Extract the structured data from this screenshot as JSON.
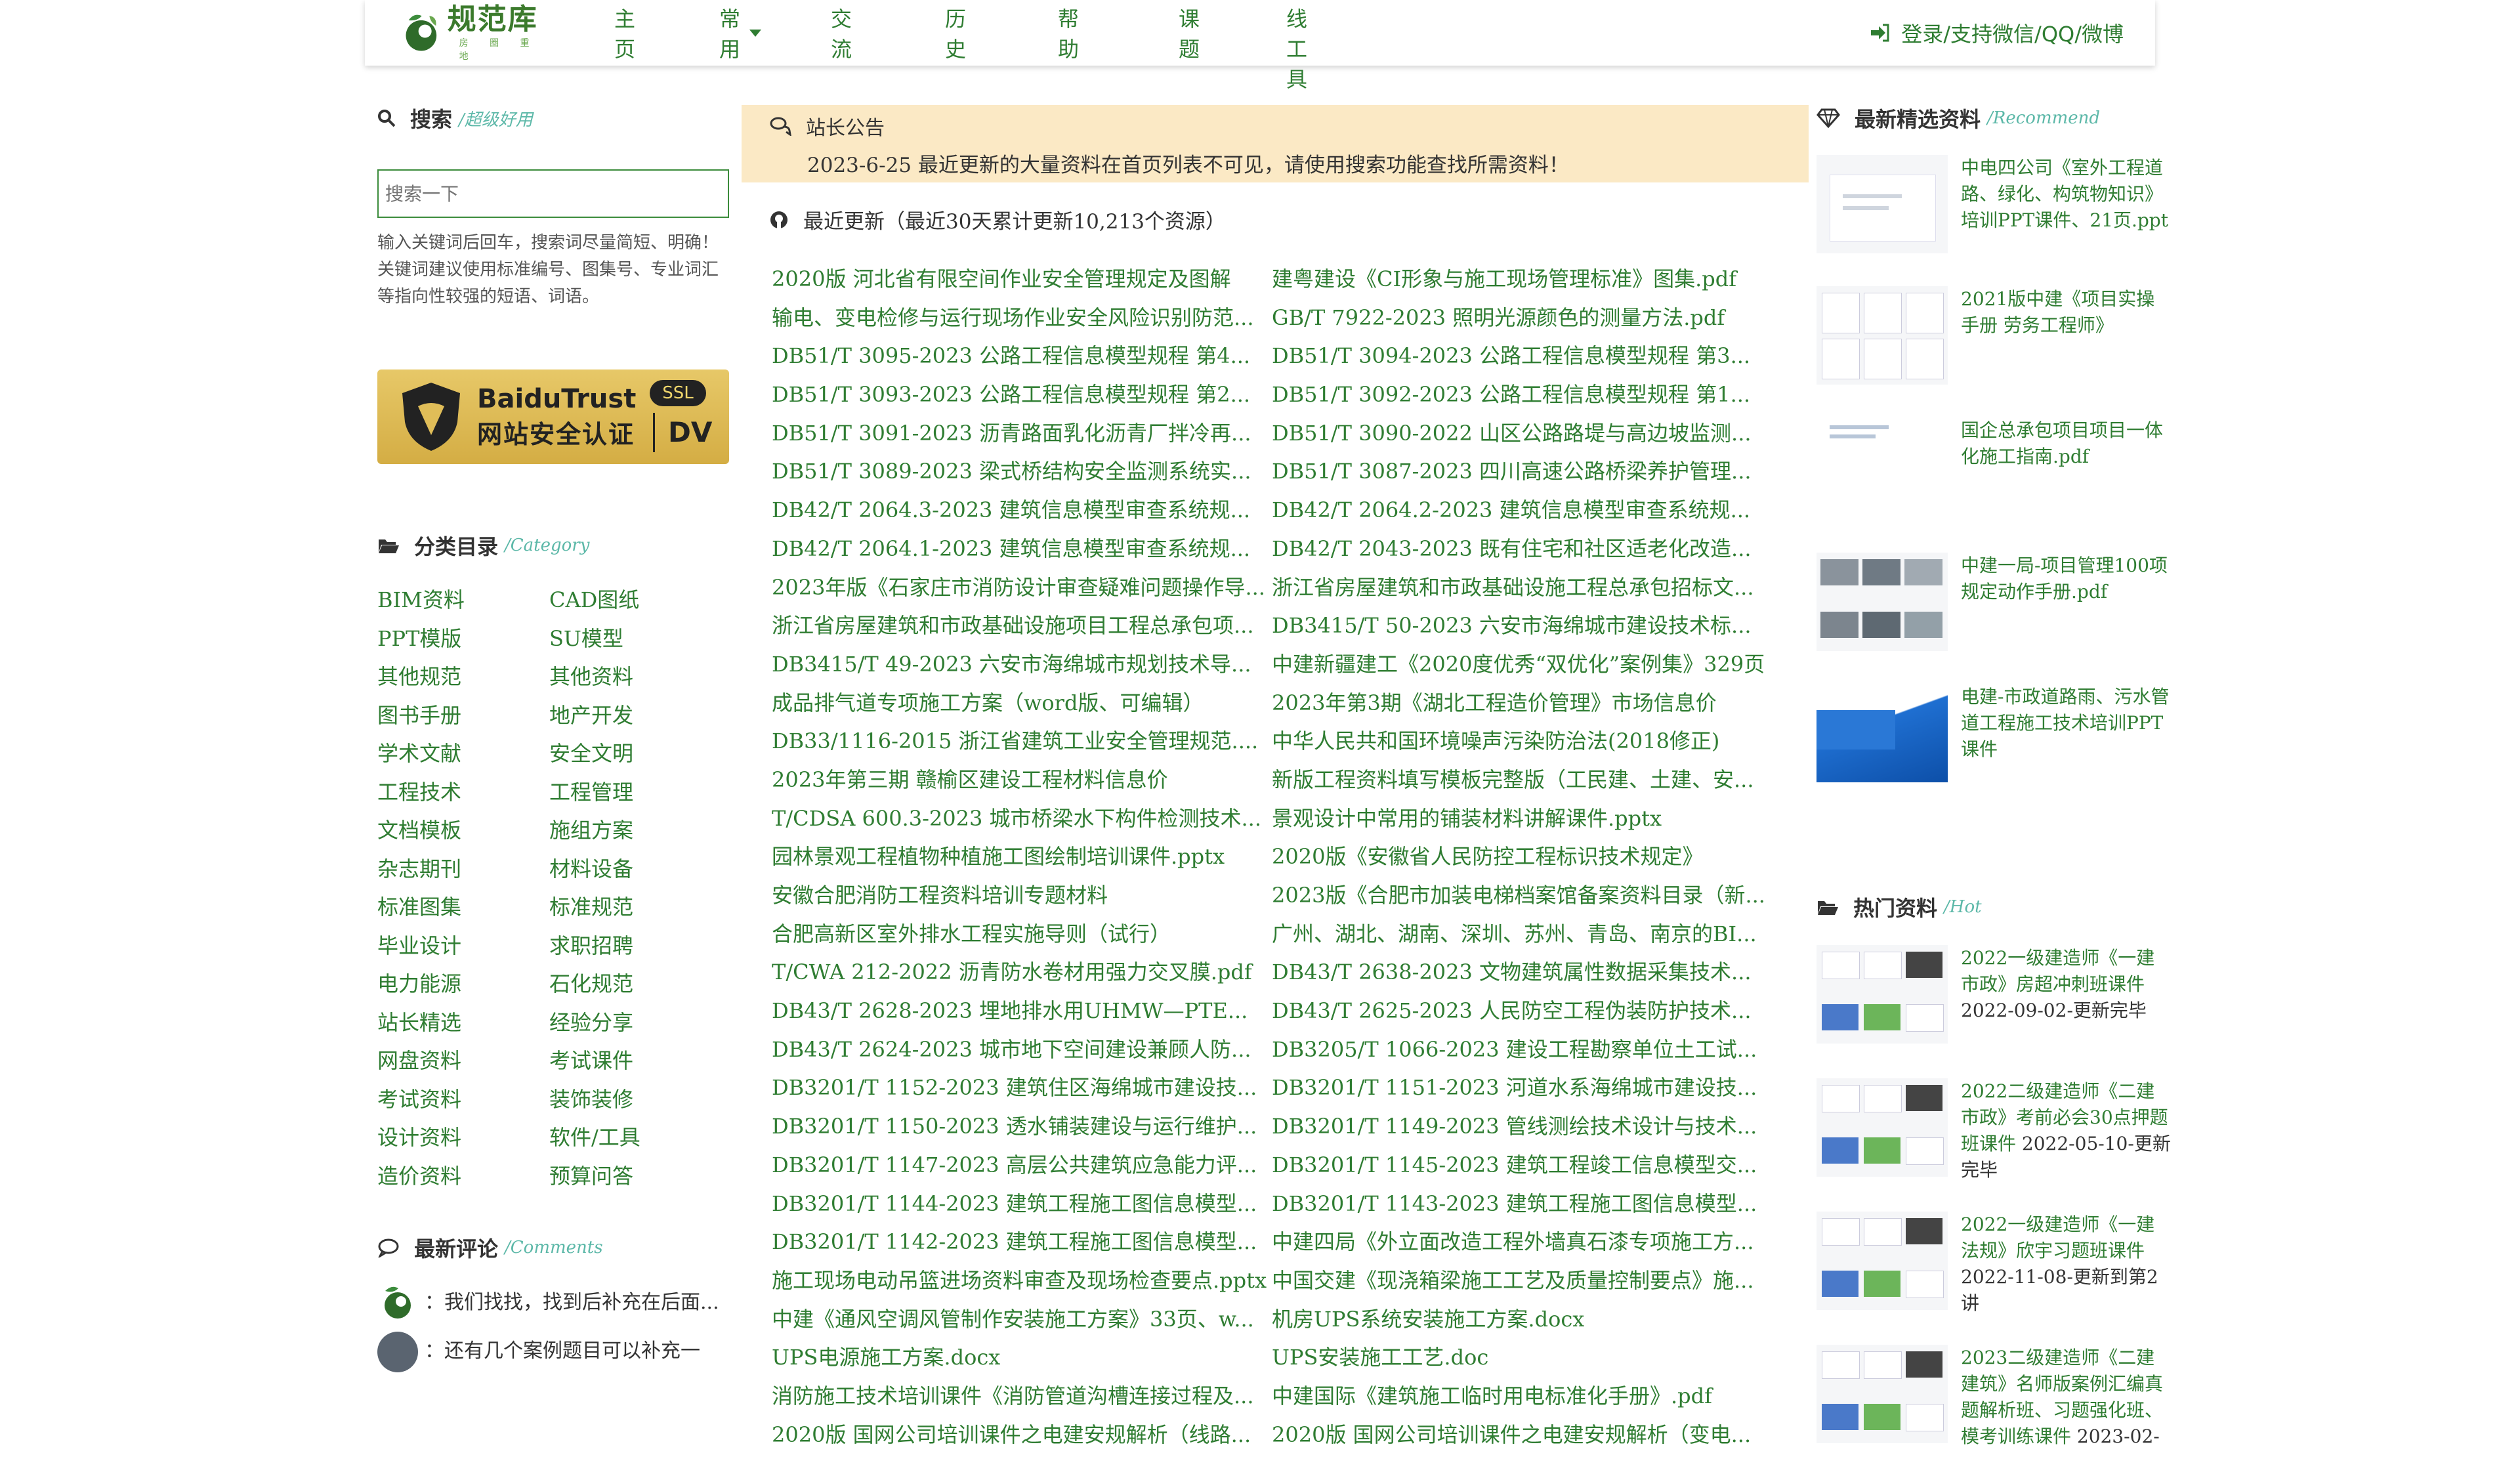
{
  "header": {
    "logo_title": "规范库",
    "logo_subtitle": "房 圈 重 地",
    "nav": [
      "主页",
      "常用",
      "交流",
      "历史",
      "帮助",
      "课题",
      "在线工具"
    ],
    "login": "登录/支持微信/QQ/微博"
  },
  "search": {
    "title": "搜索",
    "subtitle": "/超级好用",
    "placeholder": "搜索一下",
    "help_line1": "输入关键词后回车，搜索词尽量简短、明确！",
    "help_line2": "关键词建议使用标准编号、图集号、专业词汇等指向性较强的短语、词语。"
  },
  "trust_badge": {
    "brand": "BaiduTrust",
    "label": "网站安全认证",
    "ssl": "SSL",
    "dv": "DV"
  },
  "category": {
    "title": "分类目录",
    "subtitle": "/Category",
    "items": [
      "BIM资料",
      "CAD图纸",
      "PPT模版",
      "SU模型",
      "其他规范",
      "其他资料",
      "图书手册",
      "地产开发",
      "学术文献",
      "安全文明",
      "工程技术",
      "工程管理",
      "文档模板",
      "施组方案",
      "杂志期刊",
      "材料设备",
      "标准图集",
      "标准规范",
      "毕业设计",
      "求职招聘",
      "电力能源",
      "石化规范",
      "站长精选",
      "经验分享",
      "网盘资料",
      "考试课件",
      "考试资料",
      "装饰装修",
      "设计资料",
      "软件/工具",
      "造价资料",
      "预算问答"
    ]
  },
  "comments": {
    "title": "最新评论",
    "subtitle": "/Comments",
    "items": [
      "：我们找找，找到后补充在后面...",
      "：还有几个案例题目可以补充一"
    ]
  },
  "notice": {
    "title": "站长公告",
    "text": "2023-6-25 最近更新的大量资料在首页列表不可见，请使用搜索功能查找所需资料！"
  },
  "recent": {
    "title": "最近更新（最近30天累计更新10,213个资源）",
    "items": [
      "2020版 河北省有限空间作业安全管理规定及图解",
      "建粤建设《CI形象与施工现场管理标准》图集.pdf",
      "输电、变电检修与运行现场作业安全风险识别防范...",
      "GB/T 7922-2023 照明光源颜色的测量方法.pdf",
      "DB51/T 3095-2023 公路工程信息模型规程 第4...",
      "DB51/T 3094-2023 公路工程信息模型规程 第3...",
      "DB51/T 3093-2023 公路工程信息模型规程 第2...",
      "DB51/T 3092-2023 公路工程信息模型规程 第1...",
      "DB51/T 3091-2023 沥青路面乳化沥青厂拌冷再...",
      "DB51/T 3090-2022 山区公路路堤与高边坡监测...",
      "DB51/T 3089-2023 梁式桥结构安全监测系统实...",
      "DB51/T 3087-2023 四川高速公路桥梁养护管理...",
      "DB42/T 2064.3-2023 建筑信息模型审查系统规...",
      "DB42/T 2064.2-2023 建筑信息模型审查系统规...",
      "DB42/T 2064.1-2023 建筑信息模型审查系统规...",
      "DB42/T 2043-2023 既有住宅和社区适老化改造...",
      "2023年版《石家庄市消防设计审查疑难问题操作导...",
      "浙江省房屋建筑和市政基础设施工程总承包招标文...",
      "浙江省房屋建筑和市政基础设施项目工程总承包项...",
      "DB3415/T 50-2023 六安市海绵城市建设技术标...",
      "DB3415/T 49-2023 六安市海绵城市规划技术导...",
      "中建新疆建工《2020度优秀“双优化”案例集》329页",
      "成品排气道专项施工方案（word版、可编辑）",
      "2023年第3期《湖北工程造价管理》市场信息价",
      "DB33/1116-2015 浙江省建筑工业安全管理规范....",
      "中华人民共和国环境噪声污染防治法(2018修正)",
      "2023年第三期 赣榆区建设工程材料信息价",
      "新版工程资料填写模板完整版（工民建、土建、安...",
      "T/CDSA 600.3-2023 城市桥梁水下构件检测技术...",
      "景观设计中常用的铺装材料讲解课件.pptx",
      "园林景观工程植物种植施工图绘制培训课件.pptx",
      "2020版《安徽省人民防控工程标识技术规定》",
      "安徽合肥消防工程资料培训专题材料",
      "2023版《合肥市加装电梯档案馆备案资料目录（新...",
      "合肥高新区室外排水工程实施导则（试行）",
      "广州、湖北、湖南、深圳、苏州、青岛、南京的BI...",
      "T/CWA 212-2022 沥青防水卷材用强力交叉膜.pdf",
      "DB43/T 2638-2023 文物建筑属性数据采集技术...",
      "DB43/T 2628-2023 埋地排水用UHMW—PTE...",
      "DB43/T 2625-2023 人民防空工程伪装防护技术...",
      "DB43/T 2624-2023 城市地下空间建设兼顾人防...",
      "DB3205/T 1066-2023 建设工程勘察单位土工试...",
      "DB3201/T 1152-2023 建筑住区海绵城市建设技...",
      "DB3201/T 1151-2023 河道水系海绵城市建设技...",
      "DB3201/T 1150-2023 透水铺装建设与运行维护...",
      "DB3201/T 1149-2023 管线测绘技术设计与技术...",
      "DB3201/T 1147-2023 高层公共建筑应急能力评...",
      "DB3201/T 1145-2023 建筑工程竣工信息模型交...",
      "DB3201/T 1144-2023 建筑工程施工图信息模型...",
      "DB3201/T 1143-2023 建筑工程施工图信息模型...",
      "DB3201/T 1142-2023 建筑工程施工图信息模型...",
      "中建四局《外立面改造工程外墙真石漆专项施工方...",
      "施工现场电动吊篮进场资料审查及现场检查要点.pptx",
      "中国交建《现浇箱梁施工工艺及质量控制要点》施...",
      "中建《通风空调风管制作安装施工方案》33页、w...",
      "机房UPS系统安装施工方案.docx",
      "UPS电源施工方案.docx",
      "UPS安装施工工艺.doc",
      "消防施工技术培训课件《消防管道沟槽连接过程及...",
      "中建国际《建筑施工临时用电标准化手册》.pdf",
      "2020版 国网公司培训课件之电建安规解析（线路...",
      "2020版 国网公司培训课件之电建安规解析（变电..."
    ]
  },
  "recommend": {
    "title": "最新精选资料",
    "subtitle": "/Recommend",
    "items": [
      "中电四公司《室外工程道路、绿化、构筑物知识》培训PPT课件、21页.ppt",
      "2021版中建《项目实操手册 劳务工程师》",
      "国企总承包项目项目一体化施工指南.pdf",
      "中建一局-项目管理100项规定动作手册.pdf",
      "电建-市政道路雨、污水管道工程施工技术培训PPT课件"
    ]
  },
  "hot": {
    "title": "热门资料",
    "subtitle": "/Hot",
    "items": [
      {
        "title": "2022一级建造师《一建市政》房超冲刺班课件",
        "date": "2022-09-02-更新完毕"
      },
      {
        "title": "2022二级建造师《二建市政》考前必会30点押题班课件",
        "date": "2022-05-10-更新完毕"
      },
      {
        "title": "2022一级建造师《一建法规》欣宇习题班课件",
        "date": "2022-11-08-更新到第2讲"
      },
      {
        "title": "2023二级建造师《二建建筑》名师版案例汇编真题解析班、习题强化班、模考训练课件",
        "date": "2023-02-"
      }
    ]
  }
}
